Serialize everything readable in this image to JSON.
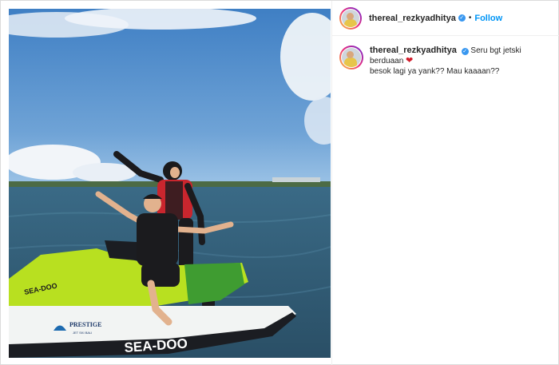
{
  "post": {
    "username": "thereal_rezkyadhitya",
    "verified_badge": "✓",
    "separator": "•",
    "follow_label": "Follow",
    "caption_text": "Seru bgt jetski berduaan",
    "caption_emoji": "❤",
    "caption_line2": "besok lagi ya yank?? Mau kaaaan??",
    "photo_brand_text": "SEA-DOO",
    "photo_dealer_text": "PRESTIGE",
    "photo_dealer_sub": "JET SKI BALI"
  },
  "colors": {
    "follow": "#0095f6",
    "verified": "#3897f0",
    "sky": "#4f87c6",
    "sea": "#2f5a78",
    "jetski_green": "#b8e020"
  }
}
